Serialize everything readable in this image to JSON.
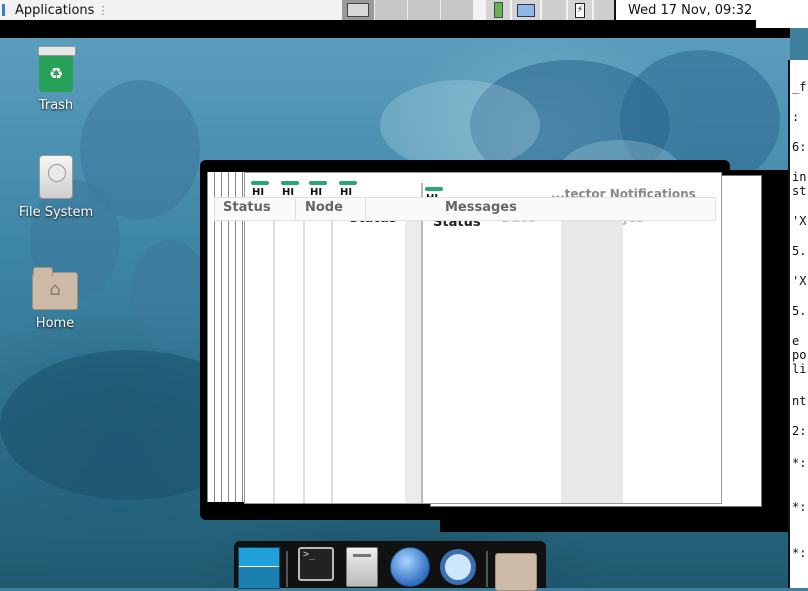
{
  "top_panel": {
    "app_menu_label": "Applications",
    "clock": "Wed 17 Nov, 09:32"
  },
  "desktop": {
    "icons": [
      {
        "label": "Trash"
      },
      {
        "label": "File System"
      },
      {
        "label": "Home"
      }
    ]
  },
  "windows": {
    "stack_header_tabs": [
      "Status",
      "Node"
    ],
    "messages_tab": "Messages",
    "column_status": "Status",
    "column_date": "Date",
    "column_messages_partial": "jes",
    "title_partial": "...tector Notifications",
    "title_partial_2": "ons",
    "hp_label": "HI"
  },
  "terminal_fragments": [
    "_f",
    ":",
    "6:",
    "in",
    "st",
    "'X",
    "5.",
    "'X",
    "5.",
    "e",
    "po",
    "li",
    "nt",
    "2:",
    "*:",
    "*:",
    "*:"
  ],
  "colors": {
    "hpe_green": "#2aa673",
    "panel_bg": "#f2f2f2",
    "trash_green": "#27a159"
  },
  "icons": {
    "trash": "recycle-icon",
    "filesystem": "hard-disk-icon",
    "home": "home-folder-icon"
  }
}
